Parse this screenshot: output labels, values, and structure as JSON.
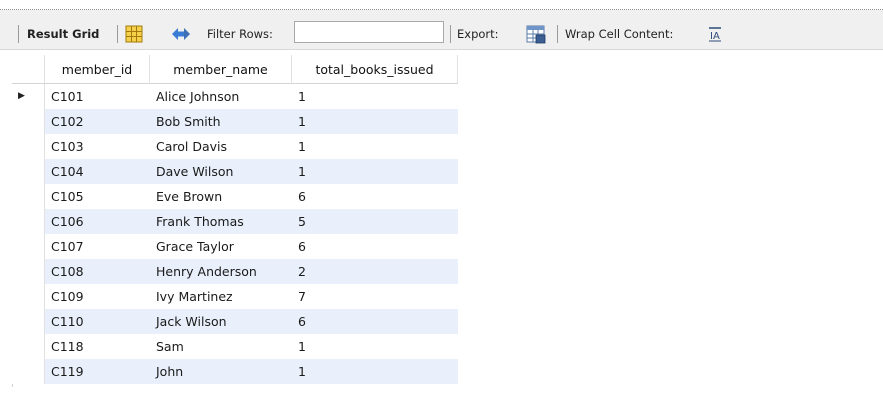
{
  "toolbar": {
    "result_grid_label": "Result Grid",
    "filter_rows_label": "Filter Rows:",
    "filter_value": "",
    "export_label": "Export:",
    "wrap_label": "Wrap Cell Content:"
  },
  "icons": {
    "grid_layout": "grid-layout-icon",
    "filter": "filter-arrows-icon",
    "export": "export-grid-icon",
    "wrap": "wrap-text-icon"
  },
  "table": {
    "columns": [
      "member_id",
      "member_name",
      "total_books_issued"
    ],
    "selected_row_marker": "▶",
    "rows": [
      [
        "C101",
        "Alice Johnson",
        "1"
      ],
      [
        "C102",
        "Bob Smith",
        "1"
      ],
      [
        "C103",
        "Carol Davis",
        "1"
      ],
      [
        "C104",
        "Dave Wilson",
        "1"
      ],
      [
        "C105",
        "Eve Brown",
        "6"
      ],
      [
        "C106",
        "Frank Thomas",
        "5"
      ],
      [
        "C107",
        "Grace Taylor",
        "6"
      ],
      [
        "C108",
        "Henry Anderson",
        "2"
      ],
      [
        "C109",
        "Ivy Martinez",
        "7"
      ],
      [
        "C110",
        "Jack Wilson",
        "6"
      ],
      [
        "C118",
        "Sam",
        "1"
      ],
      [
        "C119",
        "John",
        "1"
      ]
    ]
  },
  "colors": {
    "alt_row": "#e9f0fb",
    "toolbar_bg": "#f0f0f0",
    "filter_icon": "#3a7bd5"
  }
}
